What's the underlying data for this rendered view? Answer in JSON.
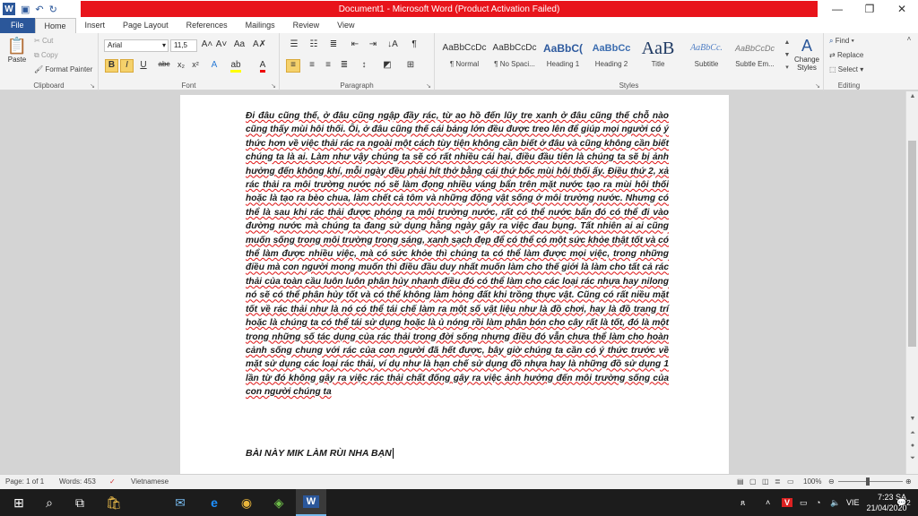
{
  "window": {
    "title": "Document1 - Microsoft Word (Product Activation Failed)",
    "controls": [
      "—",
      "❐",
      "✕"
    ]
  },
  "qat": {
    "word_icon": "W",
    "save_icon": "save-icon",
    "undo_icon": "↶",
    "redo_icon": "↻"
  },
  "tabs": [
    "File",
    "Home",
    "Insert",
    "Page Layout",
    "References",
    "Mailings",
    "Review",
    "View"
  ],
  "ribbon": {
    "clipboard": {
      "label": "Clipboard",
      "paste": "Paste",
      "cut": "Cut",
      "copy": "Copy",
      "format_painter": "Format Painter"
    },
    "font": {
      "label": "Font",
      "name": "Arial",
      "size": "11,5"
    },
    "paragraph": {
      "label": "Paragraph"
    },
    "styles": {
      "label": "Styles",
      "items": [
        {
          "sample": "AaBbCcDc",
          "name": "¶ Normal"
        },
        {
          "sample": "AaBbCcDc",
          "name": "¶ No Spaci..."
        },
        {
          "sample": "AaBbC(",
          "name": "Heading 1"
        },
        {
          "sample": "AaBbCc",
          "name": "Heading 2"
        },
        {
          "sample": "AaB",
          "name": "Title"
        },
        {
          "sample": "AaBbCc.",
          "name": "Subtitle"
        },
        {
          "sample": "AaBbCcDc",
          "name": "Subtle Em..."
        }
      ],
      "change": "Change Styles"
    },
    "editing": {
      "label": "Editing",
      "find": "Find",
      "replace": "Replace",
      "select": "Select"
    }
  },
  "document": {
    "paragraph": "Đi đâu cũng thế, ở đâu cũng ngập đầy rác, từ ao hồ đến lũy tre xanh ở đâu cũng thế chỗ nào cũng thấy mùi hôi thối. Ôi, ở đâu cũng thế cái bảng lớn đều được treo lên để giúp mọi người có ý thức hơn về việc thải rác ra ngoài một cách tùy tiện không cần biết ở đâu và cũng không cần biết chúng ta là ai. Làm như vậy chúng ta sẽ có rất nhiều cái hại, điều đầu tiên là chúng ta sẽ bị ảnh hưởng đến không khí, mỗi ngày đều phải hít thở bằng cái thứ bốc mùi hôi thối ấy. Điều thứ 2, xả rác thải ra môi trường nước nó sẽ làm đọng nhiều váng bẩn trên mặt nước tạo ra mùi hôi thối hoặc là tạo ra bèo chua, làm chết cả tôm và những động vật sống ở môi trường nước. Nhưng có thể là sau khi rác thải được phóng ra môi trường nước, rất có thể nước bẩn đó có thể đi vào đường nước mà chúng ta đang sử dụng hằng ngày gây ra việc đau bụng. Tất nhiên ai ai cũng muốn sống trong môi trường trong sáng, xanh sạch đẹp để có thể có một sức khỏe thật tốt và có thể làm được nhiều việc, mà có sức khỏe thì chúng ta có thể làm được mọi việc, trong những điều mà con người mong muốn thì điều đầu duy nhất muốn làm cho thế giới là làm cho tất cả rác thải của toàn cầu luôn luôn phân hủy nhanh điều đó có thể làm cho các loại rác nhựa hay nilong nó sẽ có thể phân hủy tốt và có thể không làm hỏng đất khi trồng thực vật. Cũng có rất niều mặt tốt về rác thải như là nó có thể tái chế làm ra một số vật liệu như là đồ chơi, hay là đồ trang trí hoặc là chúng ta có thể tái sử dụng hoặc là ủ nóng rồi làm phân bón cho cây rất là tốt, đó là một trong những số tác dụng của rác thải trong đời sống nhưng điều đó vẫn chưa thể làm cho hoàn cảnh sống chung với rác của con người đã hết được, bây giờ chúng ta cần có ý thức trước về mặt sử dụng các loại rác thải, ví dụ như là hạn chế sử dụng đồ nhựa hay là những đồ sử dụng 1 lần từ đó không gây ra việc rác thải chất đống gây ra việc ảnh hưởng đến môi trường sống của con người chúng ta",
    "closing": "BÀI NÀY MIK LÀM RÙI NHA BẠN"
  },
  "statusbar": {
    "page": "Page: 1 of 1",
    "words": "Words: 453",
    "language": "Vietnamese",
    "zoom": "100%"
  },
  "taskbar": {
    "ime": "VIE",
    "time": "7:23 SA",
    "date": "21/04/2020",
    "notifications": "2"
  }
}
